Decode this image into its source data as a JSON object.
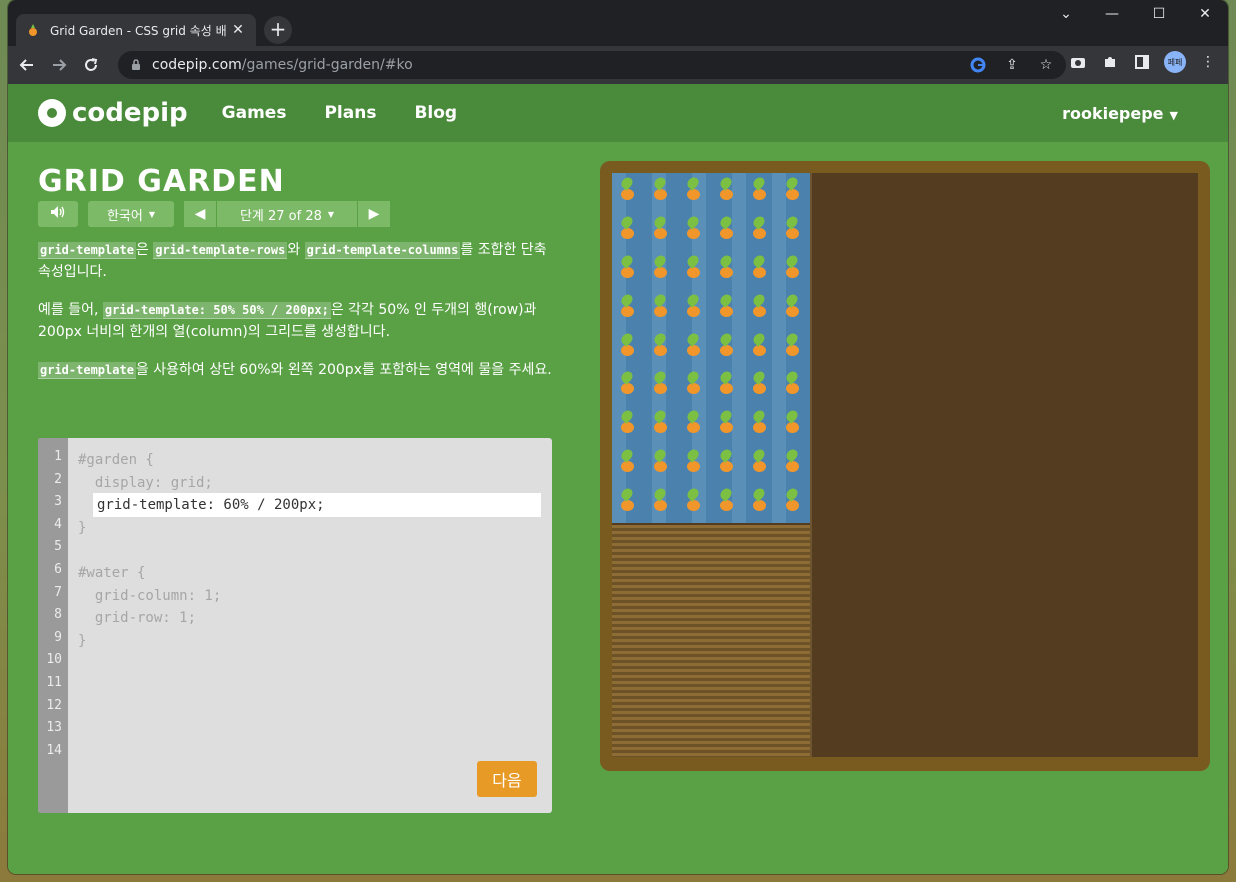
{
  "browser": {
    "tab_title": "Grid Garden - CSS grid 속성 배",
    "new_tab": "+",
    "url_host": "codepip.com",
    "url_path": "/games/grid-garden/#ko",
    "profile_initials": "페페"
  },
  "site": {
    "logo_text": "codepip",
    "nav": [
      "Games",
      "Plans",
      "Blog"
    ],
    "user": "rookiepepe"
  },
  "game": {
    "title": "GRID GARDEN",
    "language": "한국어",
    "level": "단계 27 of 28",
    "instructions": {
      "p1_code1": "grid-template",
      "p1_text1": "은 ",
      "p1_code2": "grid-template-rows",
      "p1_text2": "와 ",
      "p1_code3": "grid-template-columns",
      "p1_text3": "를 조합한 단축 속성입니다.",
      "p2_text1": "예를 들어, ",
      "p2_code1": "grid-template: 50% 50% / 200px;",
      "p2_text2": "은 각각 50% 인 두개의 행(row)과 200px 너비의 한개의 열(column)의 그리드를 생성합니다.",
      "p3_code1": "grid-template",
      "p3_text1": "을 사용하여 상단 60%와 왼쪽 200px를 포함하는 영역에 물을 주세요."
    },
    "editor": {
      "line_numbers": [
        "1",
        "2",
        "3",
        "4",
        "5",
        "6",
        "7",
        "8",
        "9",
        "10",
        "11",
        "12",
        "13",
        "14"
      ],
      "lines": [
        "#garden {",
        "  display: grid;",
        "",
        "}",
        "",
        "#water {",
        "  grid-column: 1;",
        "  grid-row: 1;",
        "}"
      ],
      "input_value": "grid-template: 60% / 200px;",
      "next_button": "다음"
    },
    "colors": {
      "page_green": "#5aa146",
      "header_green": "#4a8a3b",
      "button_orange": "#e89a26",
      "water_blue": "#4a82ad",
      "soil_brown": "#543c20"
    }
  }
}
